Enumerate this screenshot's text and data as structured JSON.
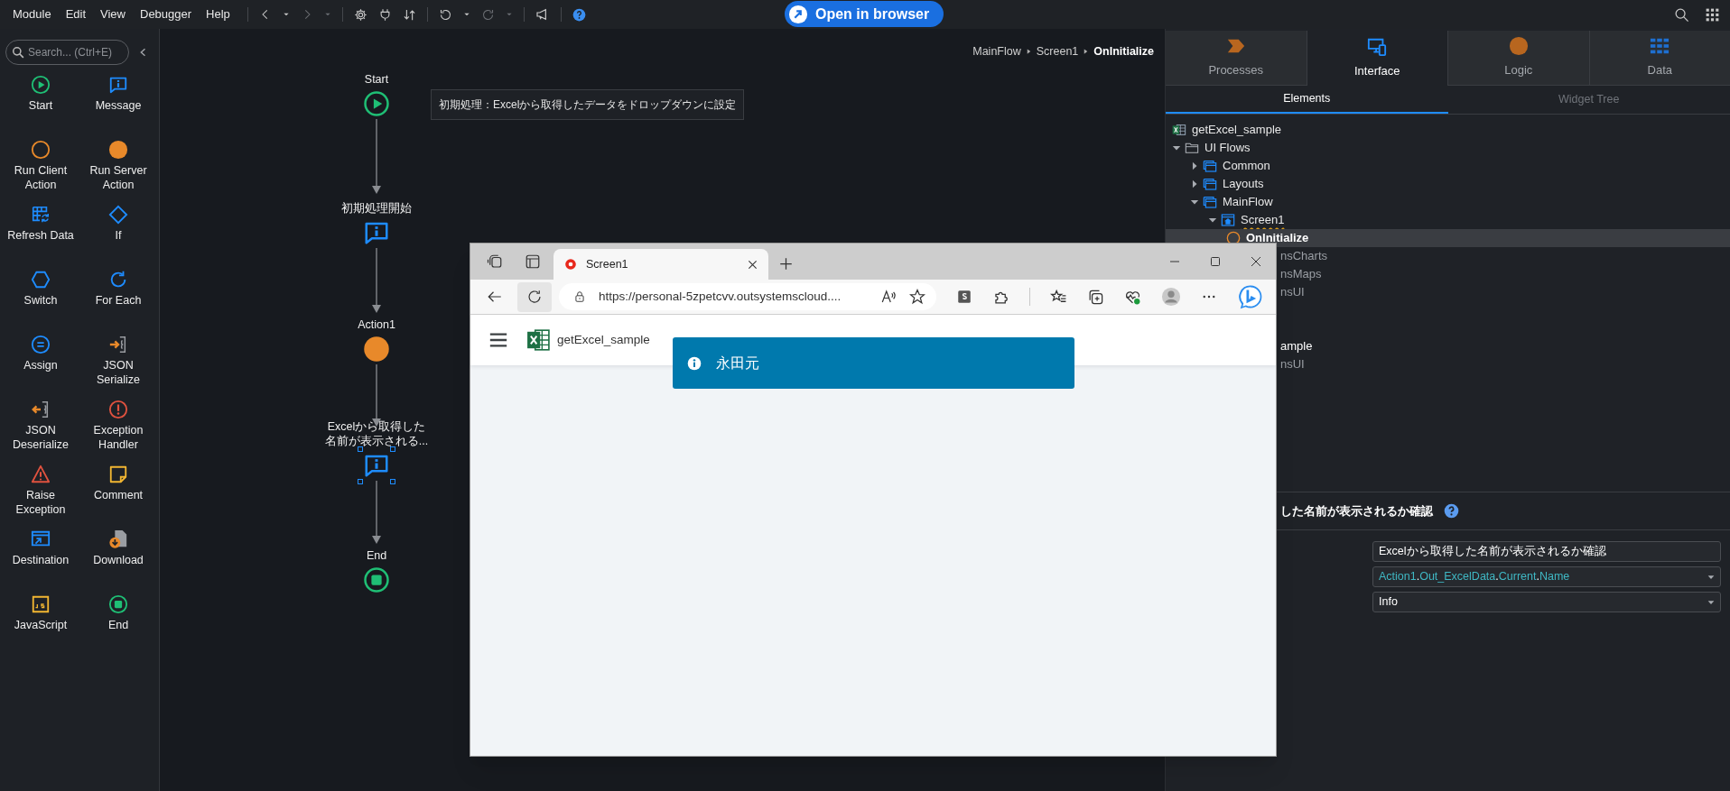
{
  "menu": [
    "Module",
    "Edit",
    "View",
    "Debugger",
    "Help"
  ],
  "open_in_browser": "Open in browser",
  "toolbox": {
    "search_placeholder": "Search... (Ctrl+E)",
    "items": [
      {
        "label": "Start",
        "kind": "start"
      },
      {
        "label": "Message",
        "kind": "message"
      },
      {
        "label": "Run Client Action",
        "kind": "run_client"
      },
      {
        "label": "Run Server Action",
        "kind": "run_server"
      },
      {
        "label": "Refresh Data",
        "kind": "refresh_data"
      },
      {
        "label": "If",
        "kind": "if"
      },
      {
        "label": "Switch",
        "kind": "switch"
      },
      {
        "label": "For Each",
        "kind": "for_each"
      },
      {
        "label": "Assign",
        "kind": "assign"
      },
      {
        "label": "JSON Serialize",
        "kind": "json_serialize"
      },
      {
        "label": "JSON Deserialize",
        "kind": "json_deserialize"
      },
      {
        "label": "Exception Handler",
        "kind": "exception_handler"
      },
      {
        "label": "Raise Exception",
        "kind": "raise_exception"
      },
      {
        "label": "Comment",
        "kind": "comment"
      },
      {
        "label": "Destination",
        "kind": "destination"
      },
      {
        "label": "Download",
        "kind": "download"
      },
      {
        "label": "JavaScript",
        "kind": "javascript"
      },
      {
        "label": "End",
        "kind": "end"
      }
    ]
  },
  "breadcrumb": [
    {
      "label": "MainFlow",
      "current": false
    },
    {
      "label": "Screen1",
      "current": false
    },
    {
      "label": "OnInitialize",
      "current": true
    }
  ],
  "flow": {
    "comment": "初期処理：Excelから取得したデータをドロップダウンに設定",
    "nodes": [
      {
        "label": "Start",
        "kind": "start",
        "selected": false
      },
      {
        "label": "初期処理開始",
        "kind": "message",
        "selected": false
      },
      {
        "label": "Action1",
        "kind": "run_server",
        "selected": false
      },
      {
        "label": "Excelから取得した名前が表示される...",
        "kind": "message",
        "selected": true
      },
      {
        "label": "End",
        "kind": "end",
        "selected": false
      }
    ]
  },
  "panel": {
    "tabs": [
      {
        "label": "Processes",
        "kind": "processes",
        "selected": false
      },
      {
        "label": "Interface",
        "kind": "interface",
        "selected": true
      },
      {
        "label": "Logic",
        "kind": "logic",
        "selected": false
      },
      {
        "label": "Data",
        "kind": "data",
        "selected": false
      }
    ],
    "subtabs": [
      {
        "label": "Elements",
        "selected": true
      },
      {
        "label": "Widget Tree",
        "selected": false
      }
    ],
    "tree": [
      {
        "label": "getExcel_sample",
        "kind": "module",
        "selected": false,
        "warning": false
      },
      {
        "label": "UI Flows",
        "kind": "folder",
        "expanded": true,
        "selected": false,
        "warning": false,
        "children": [
          {
            "label": "Common",
            "kind": "flow",
            "expanded": false,
            "selected": false,
            "warning": false
          },
          {
            "label": "Layouts",
            "kind": "flow",
            "expanded": false,
            "selected": false,
            "warning": false
          },
          {
            "label": "MainFlow",
            "kind": "flow",
            "expanded": true,
            "selected": false,
            "warning": false,
            "children": [
              {
                "label": "Screen1",
                "kind": "screen",
                "expanded": true,
                "selected": false,
                "warning": true,
                "children": [
                  {
                    "label": "OnInitialize",
                    "kind": "action",
                    "selected": true,
                    "warning": false
                  }
                ]
              }
            ]
          }
        ]
      }
    ],
    "tree_partial": [
      {
        "label": "nsCharts",
        "kind": "dependency"
      },
      {
        "label": "nsMaps",
        "kind": "dependency"
      },
      {
        "label": "nsUI",
        "kind": "dependency"
      },
      {
        "label": "ample",
        "kind": "module"
      },
      {
        "label": "nsUI",
        "kind": "dependency"
      }
    ],
    "properties": {
      "title": "した名前が表示されるか確認",
      "fields": [
        {
          "kind": "text",
          "value": "Excelから取得した名前が表示されるか確認"
        },
        {
          "kind": "expression",
          "parts": [
            {
              "text": "Action1",
              "kind": "name"
            },
            {
              "text": ".",
              "kind": "dot"
            },
            {
              "text": "Out_ExcelData",
              "kind": "name"
            },
            {
              "text": ".",
              "kind": "dot"
            },
            {
              "text": "Current",
              "kind": "name"
            },
            {
              "text": ".",
              "kind": "dot"
            },
            {
              "text": "Name",
              "kind": "name"
            }
          ]
        },
        {
          "kind": "select",
          "value": "Info"
        }
      ]
    }
  },
  "browser": {
    "tab_title": "Screen1",
    "url": "https://personal-5zpetcvv.outsystemscloud....",
    "app_title": "getExcel_sample",
    "toast": "永田元"
  }
}
